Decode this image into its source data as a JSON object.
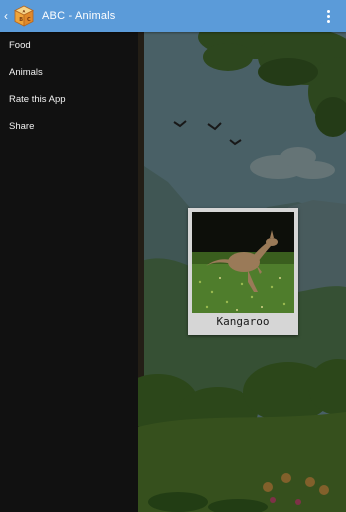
{
  "actionbar": {
    "title": "ABC - Animals",
    "bg_color": "#5b9bd9",
    "up_icon": "chevron-left-icon",
    "app_icon": "abc-cube-icon",
    "overflow_icon": "more-vert-icon"
  },
  "drawer": {
    "items": [
      {
        "label": "Food"
      },
      {
        "label": "Animals"
      },
      {
        "label": "Rate this App"
      },
      {
        "label": "Share"
      }
    ]
  },
  "card": {
    "caption": "Kangaroo"
  }
}
